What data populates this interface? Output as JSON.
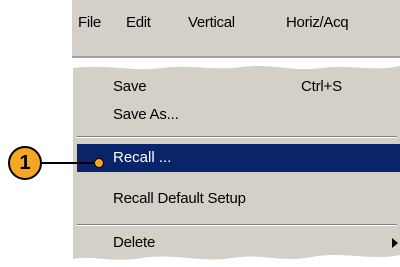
{
  "menubar": {
    "items": [
      {
        "label": "File"
      },
      {
        "label": "Edit"
      },
      {
        "label": "Vertical"
      },
      {
        "label": "Horiz/Acq"
      }
    ]
  },
  "file_menu": {
    "items": [
      {
        "label": "Save",
        "shortcut": "Ctrl+S"
      },
      {
        "label": "Save As..."
      },
      {
        "label": "Recall ..."
      },
      {
        "label": "Recall Default Setup"
      },
      {
        "label": "Delete"
      }
    ],
    "highlight_color": "#0a246a"
  },
  "callout": {
    "number": "1",
    "color": "#f5a623"
  }
}
